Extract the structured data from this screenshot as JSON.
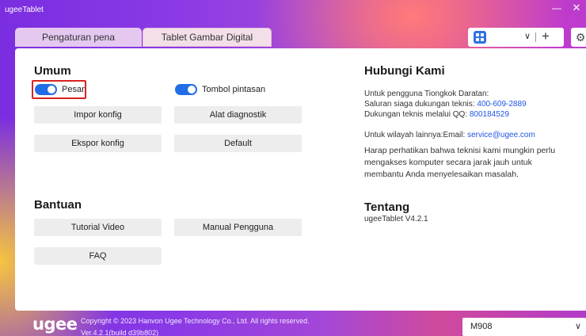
{
  "app": {
    "title": "ugeeTablet"
  },
  "window": {
    "minimize_icon": "minimize-icon",
    "close_icon": "close-icon",
    "minimize_glyph": "—",
    "close_glyph": "✕"
  },
  "tabs": [
    {
      "label": "Pengaturan pena"
    },
    {
      "label": "Tablet Gambar Digital"
    }
  ],
  "device_bar": {
    "device_icon": "grid-icon",
    "chevron": "∨",
    "plus": "+"
  },
  "settings_icon": "⚙",
  "general": {
    "title": "Umum",
    "toggle_message": "Pesan",
    "toggle_shortcut": "Tombol pintasan",
    "import_label": "Impor konfig",
    "diagnostic_label": "Alat diagnostik",
    "export_label": "Ekspor konfig",
    "default_label": "Default"
  },
  "help": {
    "title": "Bantuan",
    "video_label": "Tutorial Video",
    "manual_label": "Manual Pengguna",
    "faq_label": "FAQ"
  },
  "contact": {
    "title": "Hubungi Kami",
    "line1": "Untuk pengguna Tiongkok Daratan:",
    "line2_prefix": "Saluran siaga dukungan teknis: ",
    "hotline": "400-609-2889",
    "line3_prefix": "Dukungan teknis melalui QQ: ",
    "qq": "800184529",
    "line4_prefix": "Untuk wilayah lainnya:Email: ",
    "email": "service@ugee.com",
    "line5": "Harap perhatikan bahwa teknisi kami mungkin perlu",
    "line6": "mengakses komputer secara jarak jauh untuk",
    "line7": "membantu Anda menyelesaikan masalah."
  },
  "about": {
    "title": "Tentang",
    "version": "ugeeTablet V4.2.1"
  },
  "footer": {
    "logo": "ugee",
    "copyright": "Copyright © 2023 Hanvon Ugee Technology Co., Ltd. All rights reserved.",
    "build": "Ver.4.2.1(build d39b802)",
    "model": "M908",
    "model_chevron": "∨"
  },
  "colors": {
    "accent": "#1f6ee6",
    "highlight": "#d92323",
    "link": "#1f55e6"
  }
}
